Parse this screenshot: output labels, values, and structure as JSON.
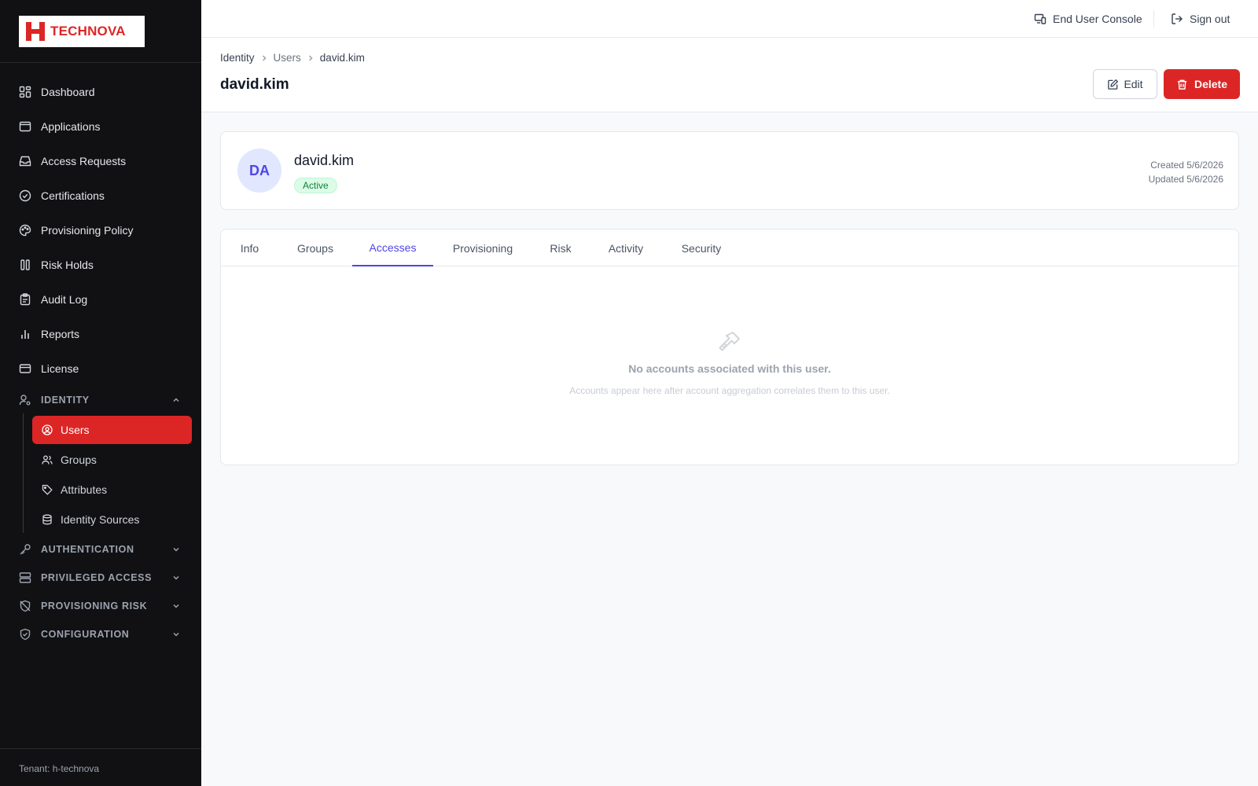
{
  "brand": {
    "name": "TECHNOVA",
    "accent": "#dc2626"
  },
  "sidebar": {
    "items": [
      {
        "label": "Dashboard",
        "icon": "dashboard-icon"
      },
      {
        "label": "Applications",
        "icon": "window-icon"
      },
      {
        "label": "Access Requests",
        "icon": "inbox-icon"
      },
      {
        "label": "Certifications",
        "icon": "check-circle-icon"
      },
      {
        "label": "Provisioning Policy",
        "icon": "palette-icon"
      },
      {
        "label": "Risk Holds",
        "icon": "columns-icon"
      },
      {
        "label": "Audit Log",
        "icon": "clipboard-icon"
      },
      {
        "label": "Reports",
        "icon": "bar-chart-icon"
      },
      {
        "label": "License",
        "icon": "card-icon"
      }
    ],
    "identity_section": {
      "label": "IDENTITY",
      "expanded": true,
      "items": [
        {
          "label": "Users",
          "icon": "user-circle-icon",
          "active": true
        },
        {
          "label": "Groups",
          "icon": "users-icon"
        },
        {
          "label": "Attributes",
          "icon": "tag-icon"
        },
        {
          "label": "Identity Sources",
          "icon": "database-icon"
        }
      ]
    },
    "sections": [
      {
        "label": "AUTHENTICATION",
        "icon": "key-icon"
      },
      {
        "label": "PRIVILEGED ACCESS",
        "icon": "server-icon"
      },
      {
        "label": "PROVISIONING RISK",
        "icon": "shield-off-icon"
      },
      {
        "label": "CONFIGURATION",
        "icon": "shield-check-icon"
      }
    ],
    "tenant": "Tenant: h-technova"
  },
  "topbar": {
    "end_user_console": "End User Console",
    "sign_out": "Sign out"
  },
  "header": {
    "breadcrumb": [
      "Identity",
      "Users",
      "david.kim"
    ],
    "title": "david.kim",
    "edit_label": "Edit",
    "delete_label": "Delete"
  },
  "profile": {
    "initials": "DA",
    "name": "david.kim",
    "status": "Active",
    "created": "Created 5/6/2026",
    "updated": "Updated 5/6/2026"
  },
  "tabs": {
    "items": [
      "Info",
      "Groups",
      "Accesses",
      "Provisioning",
      "Risk",
      "Activity",
      "Security"
    ],
    "active": "Accesses"
  },
  "empty_state": {
    "icon": "key-icon",
    "title": "No accounts associated with this user.",
    "subtitle": "Accounts appear here after account aggregation correlates them to this user."
  }
}
